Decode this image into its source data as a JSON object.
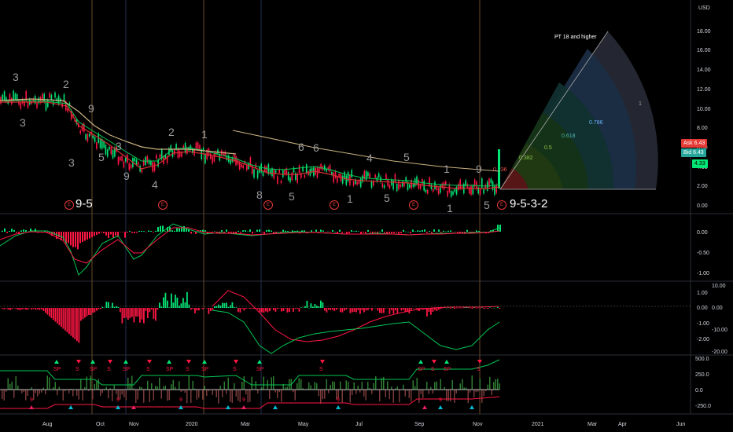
{
  "currency": "USD",
  "price_axis": [
    "18.00",
    "16.00",
    "14.00",
    "12.00",
    "10.00",
    "8.00",
    "6.00",
    "4.00",
    "2.00",
    "0.00"
  ],
  "ask_badge": {
    "label": "Ask",
    "value": "6.43",
    "color": "#e53935"
  },
  "bid_badge": {
    "label": "Bid",
    "value": "6.43",
    "color": "#26a69a"
  },
  "last_badge": {
    "value": "4.33",
    "color": "#00e676"
  },
  "fib_title": "PT 18 and higher",
  "fib_levels": [
    "0.236",
    "0.382",
    "0.5",
    "0.618",
    "0.786",
    "1"
  ],
  "wave_left": "9-5",
  "wave_right": "9-5-3-2",
  "count_labels": [
    "3",
    "3",
    "3",
    "2",
    "9",
    "5",
    "3",
    "9",
    "4",
    "2",
    "1",
    "8",
    "5",
    "6",
    "6",
    "4",
    "5",
    "1",
    "5",
    "1",
    "1",
    "9",
    "5"
  ],
  "earnings_marker": "E",
  "macd_axis": [
    "0.00",
    "-0.50",
    "-1.00"
  ],
  "osc_axis_left": [
    "1.00",
    "0.00",
    "-1.00",
    "-2.00"
  ],
  "osc_axis_right": [
    "10.00",
    "0.00",
    "-10.00",
    "-20.00"
  ],
  "cci_axis": [
    "500.0",
    "250.0",
    "0.0",
    "-250.0"
  ],
  "signal_labels": [
    "SP",
    "S",
    "9"
  ],
  "time_axis": [
    "Aug",
    "Oct",
    "Nov",
    "2020",
    "Mar",
    "May",
    "Jul",
    "Sep",
    "Nov",
    "2021",
    "Mar",
    "Apr",
    "Jun"
  ],
  "colors": {
    "up": "#00e676",
    "down": "#ff1744",
    "ma": "#e0c089",
    "grid": "#1e222d"
  }
}
